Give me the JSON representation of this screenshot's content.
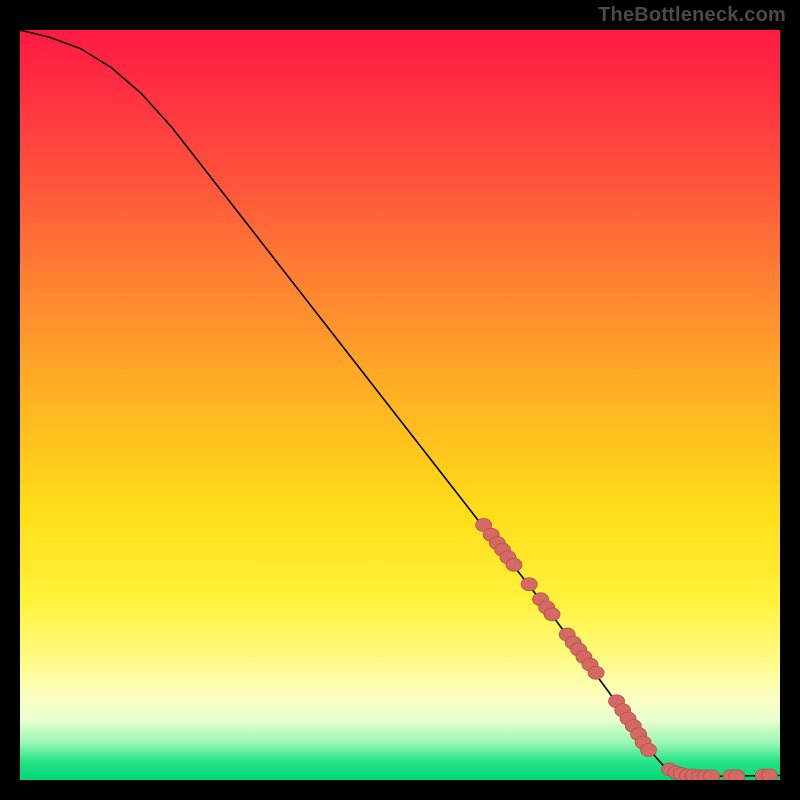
{
  "attribution": "TheBottleneck.com",
  "chart_data": {
    "type": "line",
    "title": "",
    "xlabel": "",
    "ylabel": "",
    "xlim": [
      0,
      100
    ],
    "ylim": [
      0,
      100
    ],
    "grid": false,
    "curve": [
      {
        "x": 0,
        "y": 100
      },
      {
        "x": 4,
        "y": 99
      },
      {
        "x": 8,
        "y": 97.5
      },
      {
        "x": 12,
        "y": 95
      },
      {
        "x": 16,
        "y": 91.5
      },
      {
        "x": 20,
        "y": 87
      },
      {
        "x": 30,
        "y": 74
      },
      {
        "x": 40,
        "y": 61
      },
      {
        "x": 50,
        "y": 48
      },
      {
        "x": 60,
        "y": 35
      },
      {
        "x": 70,
        "y": 22
      },
      {
        "x": 78,
        "y": 11
      },
      {
        "x": 82,
        "y": 5
      },
      {
        "x": 85,
        "y": 1.5
      },
      {
        "x": 88,
        "y": 0.6
      },
      {
        "x": 92,
        "y": 0.5
      },
      {
        "x": 100,
        "y": 0.6
      }
    ],
    "markers": [
      {
        "x": 61.0,
        "y": 34.0
      },
      {
        "x": 62.0,
        "y": 32.7
      },
      {
        "x": 62.8,
        "y": 31.6
      },
      {
        "x": 63.5,
        "y": 30.7
      },
      {
        "x": 64.2,
        "y": 29.7
      },
      {
        "x": 65.0,
        "y": 28.7
      },
      {
        "x": 67.0,
        "y": 26.1
      },
      {
        "x": 68.5,
        "y": 24.1
      },
      {
        "x": 69.3,
        "y": 23.0
      },
      {
        "x": 70.0,
        "y": 22.1
      },
      {
        "x": 72.0,
        "y": 19.4
      },
      {
        "x": 72.8,
        "y": 18.3
      },
      {
        "x": 73.5,
        "y": 17.4
      },
      {
        "x": 74.2,
        "y": 16.4
      },
      {
        "x": 75.0,
        "y": 15.4
      },
      {
        "x": 75.8,
        "y": 14.3
      },
      {
        "x": 78.5,
        "y": 10.5
      },
      {
        "x": 79.3,
        "y": 9.3
      },
      {
        "x": 80.0,
        "y": 8.2
      },
      {
        "x": 80.7,
        "y": 7.2
      },
      {
        "x": 81.4,
        "y": 6.1
      },
      {
        "x": 82.0,
        "y": 5.0
      },
      {
        "x": 82.7,
        "y": 4.0
      },
      {
        "x": 85.5,
        "y": 1.4
      },
      {
        "x": 86.3,
        "y": 1.0
      },
      {
        "x": 87.0,
        "y": 0.8
      },
      {
        "x": 87.8,
        "y": 0.6
      },
      {
        "x": 88.6,
        "y": 0.6
      },
      {
        "x": 89.4,
        "y": 0.5
      },
      {
        "x": 90.2,
        "y": 0.5
      },
      {
        "x": 91.0,
        "y": 0.5
      },
      {
        "x": 93.5,
        "y": 0.5
      },
      {
        "x": 94.3,
        "y": 0.5
      },
      {
        "x": 97.8,
        "y": 0.6
      },
      {
        "x": 98.6,
        "y": 0.6
      }
    ],
    "colors": {
      "curve": "#000000",
      "marker_fill": "#d46a63",
      "marker_stroke": "#b24f49"
    }
  }
}
